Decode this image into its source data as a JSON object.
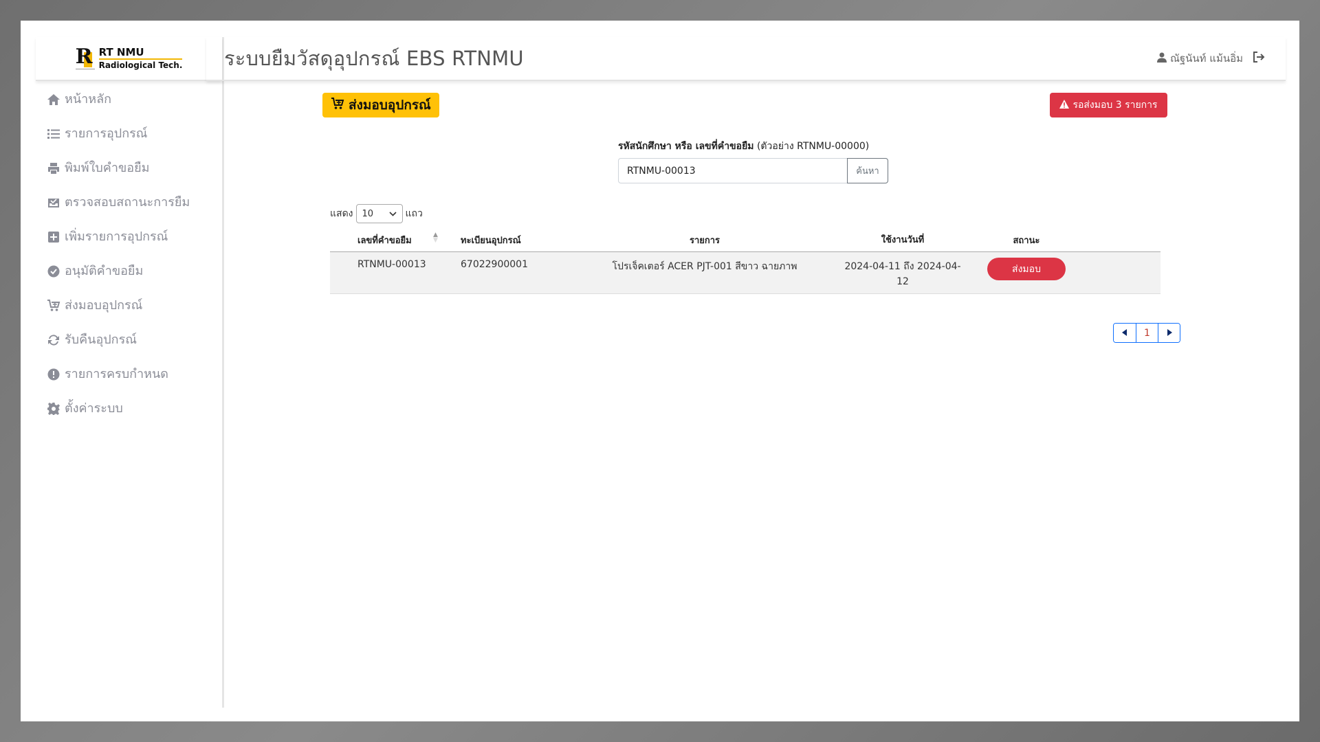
{
  "app": {
    "logo_line1": "RT NMU",
    "logo_line2": "Radiological Tech.",
    "title": "ระบบยืมวัสดุอุปกรณ์ EBS RTNMU"
  },
  "user": {
    "name": "ณัฐนันท์ แม้นอิ่ม",
    "icon": "user-icon",
    "logout_icon": "logout-icon"
  },
  "sidebar": {
    "items": [
      {
        "label": "หน้าหลัก",
        "icon": "home-icon"
      },
      {
        "label": "รายการอุปกรณ์",
        "icon": "list-icon"
      },
      {
        "label": "พิมพ์ใบคำขอยืม",
        "icon": "printer-icon"
      },
      {
        "label": "ตรวจสอบสถานะการยืม",
        "icon": "inbox-check-icon"
      },
      {
        "label": "เพิ่มรายการอุปกรณ์",
        "icon": "plus-square-icon"
      },
      {
        "label": "อนุมัติคำขอยืม",
        "icon": "check-circle-icon"
      },
      {
        "label": "ส่งมอบอุปกรณ์",
        "icon": "cart-plus-icon"
      },
      {
        "label": "รับคืนอุปกรณ์",
        "icon": "refresh-icon"
      },
      {
        "label": "รายการครบกำหนด",
        "icon": "exclamation-circle-icon"
      },
      {
        "label": "ตั้งค่าระบบ",
        "icon": "gear-icon"
      }
    ]
  },
  "main": {
    "section_title": "ส่งมอบอุปกรณ์",
    "pending_badge": "รอส่งมอบ 3 รายการ",
    "search_label_bold": "รหัสนักศึกษา หรือ เลขที่คำขอยืม",
    "search_label_hint": "(ตัวอย่าง RTNMU-00000)",
    "search_value": "RTNMU-00013",
    "search_button": "ค้นหา",
    "length_prefix": "แสดง",
    "length_value": "10",
    "length_suffix": "แถว",
    "table": {
      "headers": [
        "เลขที่คำขอยืม",
        "ทะเบียนอุปกรณ์",
        "รายการ",
        "ใช้งานวันที่",
        "สถานะ"
      ],
      "rows": [
        {
          "request_no": "RTNMU-00013",
          "asset_no": "67022900001",
          "item": "โปรเจ็คเตอร์ ACER PJT-001 สีขาว ฉายภาพ",
          "date_range": "2024-04-11 ถึง 2024-04-12",
          "status": "ส่งมอบ"
        }
      ]
    },
    "pagination": {
      "current": "1",
      "prev_icon": "caret-left-icon",
      "next_icon": "caret-right-icon"
    }
  },
  "colors": {
    "accent_yellow": "#ffc107",
    "danger_red": "#dc3545",
    "pagination_blue": "#0d6efd",
    "sidebar_text": "#8b8d97"
  }
}
